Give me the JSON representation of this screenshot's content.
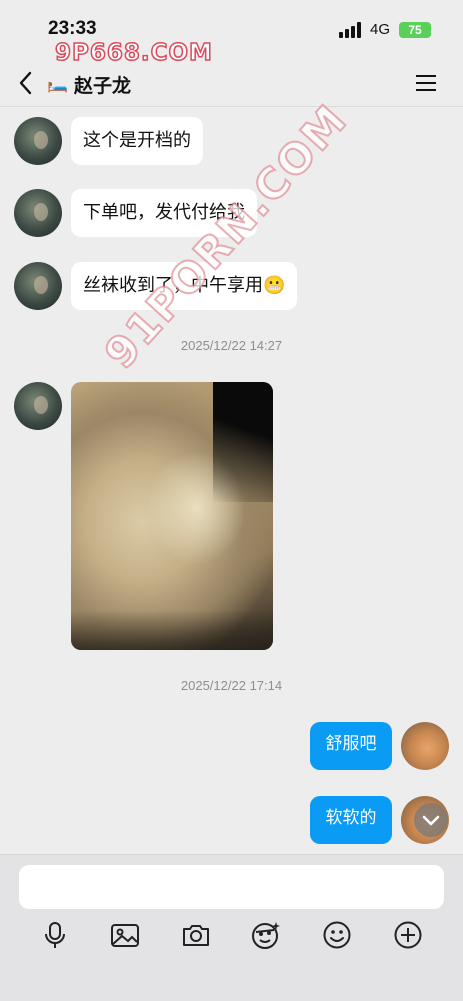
{
  "status_bar": {
    "time": "23:33",
    "network": "4G",
    "battery": "75"
  },
  "watermarks": {
    "top": "9P668.COM",
    "diagonal": "91PORN.COM"
  },
  "header": {
    "contact_name": "赵子龙",
    "name_prefix_icon": "bed-icon"
  },
  "messages": [
    {
      "side": "left",
      "text": "这个是开档的"
    },
    {
      "side": "left",
      "text": "下单吧，发代付给我"
    },
    {
      "side": "left",
      "text": "丝袜收到了，中午享用😬"
    },
    {
      "side": "left",
      "type": "image"
    },
    {
      "side": "right",
      "text": "舒服吧"
    },
    {
      "side": "right",
      "text": "软软的"
    }
  ],
  "timestamps": [
    "2025/12/22 14:27",
    "2025/12/22 17:14"
  ],
  "input": {
    "placeholder": ""
  },
  "toolbar": [
    "microphone-icon",
    "image-icon",
    "camera-icon",
    "sticker-icon",
    "emoji-icon",
    "plus-icon"
  ],
  "colors": {
    "background": "#ededed",
    "my_bubble": "#0a9cf5",
    "their_bubble": "#ffffff",
    "battery": "#5ad05a"
  }
}
